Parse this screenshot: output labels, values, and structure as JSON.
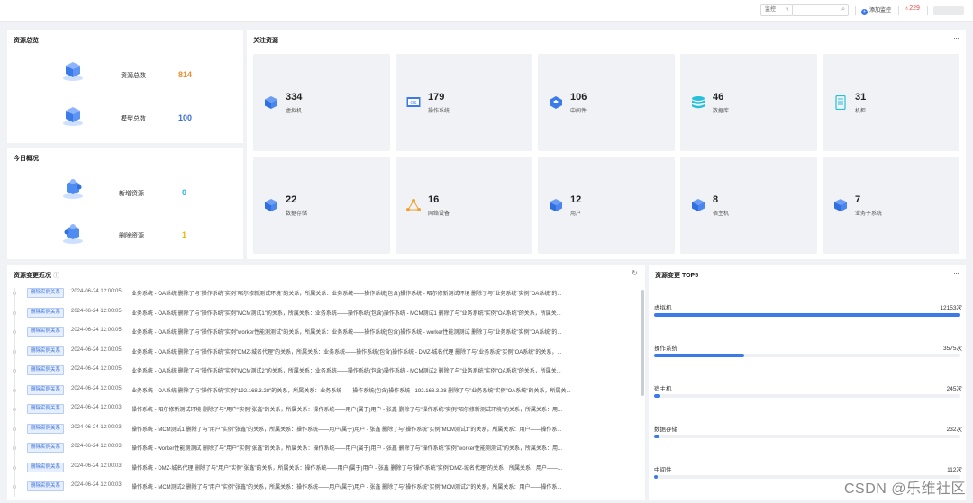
{
  "topbar": {
    "select_value": "监控",
    "add_label": "添加监控",
    "alert_count": "229"
  },
  "summary": {
    "title": "资源总览",
    "items": [
      {
        "label": "资源总数",
        "value": "814",
        "color": "#f08c2e"
      },
      {
        "label": "模型总数",
        "value": "100",
        "color": "#3a6fd8"
      }
    ]
  },
  "today": {
    "title": "今日概况",
    "items": [
      {
        "label": "新增资源",
        "value": "0",
        "color": "#2bb3e6"
      },
      {
        "label": "删除资源",
        "value": "1",
        "color": "#f0b400"
      }
    ]
  },
  "focus": {
    "title": "关注资源",
    "more": "···",
    "cards": [
      {
        "count": "334",
        "label": "虚拟机",
        "icon": "cube-icon"
      },
      {
        "count": "179",
        "label": "操作系统",
        "icon": "os-icon"
      },
      {
        "count": "106",
        "label": "中间件",
        "icon": "cube-icon"
      },
      {
        "count": "46",
        "label": "数据库",
        "icon": "database-icon"
      },
      {
        "count": "31",
        "label": "机柜",
        "icon": "cabinet-icon"
      },
      {
        "count": "22",
        "label": "数据存储",
        "icon": "cube-icon"
      },
      {
        "count": "16",
        "label": "网络设备",
        "icon": "network-icon"
      },
      {
        "count": "12",
        "label": "用户",
        "icon": "cube-icon"
      },
      {
        "count": "8",
        "label": "宿主机",
        "icon": "cube-icon"
      },
      {
        "count": "7",
        "label": "业务子系统",
        "icon": "cube-icon"
      }
    ]
  },
  "changes": {
    "title": "资源变更近况",
    "rows": [
      {
        "badge": "删除实例关系",
        "time": "2024-06-24 12:00:05",
        "text": "业务系统 - OA系统   删除了与\"操作系统\"实例\"昭尔修新测试环境\"的关系，所属关系：业务系统——操作系统(包含)操作系统 - 昭尔修新测试环境   删除了与\"业务系统\"实例\"OA系统\"的..."
      },
      {
        "badge": "删除实例关系",
        "time": "2024-06-24 12:00:05",
        "text": "业务系统 - OA系统   删除了与\"操作系统\"实例\"MCM测试1\"的关系，所属关系：业务系统——操作系统(包含)操作系统 - MCM测试1   删除了与\"业务系统\"实例\"OA系统\"的关系，所属关..."
      },
      {
        "badge": "删除实例关系",
        "time": "2024-06-24 12:00:05",
        "text": "业务系统 - OA系统   删除了与\"操作系统\"实例\"worker性能测测试\"的关系，所属关系：业务系统——操作系统(包含)操作系统 - worker性能测测试   删除了与\"业务系统\"实例\"OA系统\"的..."
      },
      {
        "badge": "删除实例关系",
        "time": "2024-06-24 12:00:05",
        "text": "业务系统 - OA系统   删除了与\"操作系统\"实例\"DMZ-城名代理\"的关系，所属关系：业务系统——操作系统(包含)操作系统 - DMZ-城名代理   删除了与\"业务系统\"实例\"OA系统\"的关系，..."
      },
      {
        "badge": "删除实例关系",
        "time": "2024-06-24 12:00:05",
        "text": "业务系统 - OA系统   删除了与\"操作系统\"实例\"MCM测试2\"的关系，所属关系：业务系统——操作系统(包含)操作系统 - MCM测试2   删除了与\"业务系统\"实例\"OA系统\"的关系，所属关..."
      },
      {
        "badge": "删除实例关系",
        "time": "2024-06-24 12:00:05",
        "text": "业务系统 - OA系统   删除了与\"操作系统\"实例\"192.168.3.28\"的关系，所属关系：业务系统——操作系统(包含)操作系统 - 192.168.3.28   删除了与\"业务系统\"实例\"OA系统\"的关系，所属关..."
      },
      {
        "badge": "删除实例关系",
        "time": "2024-06-24 12:00:03",
        "text": "操作系统 - 昭尔修新测试环境   删除了与\"用户\"实例\"张鑫\"的关系，所属关系：操作系统——用户(属于)用户 - 张鑫   删除了与\"操作系统\"实例\"昭尔修新测试环境\"的关系，所属关系：用..."
      },
      {
        "badge": "删除实例关系",
        "time": "2024-06-24 12:00:03",
        "text": "操作系统 - MCM测试1   删除了与\"用户\"实例\"张鑫\"的关系，所属关系：操作系统——用户(属于)用户 - 张鑫   删除了与\"操作系统\"实例\"MCM测试1\"的关系，所属关系：用户——操作系..."
      },
      {
        "badge": "删除实例关系",
        "time": "2024-06-24 12:00:03",
        "text": "操作系统 - worker性能测测试   删除了与\"用户\"实例\"张鑫\"的关系，所属关系：操作系统——用户(属于)用户 - 张鑫   删除了与\"操作系统\"实例\"worker性能测测试\"的关系，所属关系：用..."
      },
      {
        "badge": "删除实例关系",
        "time": "2024-06-24 12:00:03",
        "text": "操作系统 - DMZ-城名代理   删除了与\"用户\"实例\"张鑫\"的关系，所属关系：操作系统——用户(属于)用户 - 张鑫   删除了与\"操作系统\"实例\"DMZ-城名代理\"的关系，所属关系：用户——..."
      },
      {
        "badge": "删除实例关系",
        "time": "2024-06-24 12:00:03",
        "text": "操作系统 - MCM测试2   删除了与\"用户\"实例\"张鑫\"的关系，所属关系：操作系统——用户(属于)用户 - 张鑫   删除了与\"操作系统\"实例\"MCM测试2\"的关系，所属关系：用户——操作系..."
      }
    ]
  },
  "tops": {
    "title": "资源变更 TOP5",
    "more": "···",
    "items": [
      {
        "label": "虚拟机",
        "value": "12153次",
        "ratio": 1.0
      },
      {
        "label": "操作系统",
        "value": "3575次",
        "ratio": 0.294
      },
      {
        "label": "宿主机",
        "value": "245次",
        "ratio": 0.02
      },
      {
        "label": "数据存储",
        "value": "232次",
        "ratio": 0.019
      },
      {
        "label": "中间件",
        "value": "112次",
        "ratio": 0.009
      }
    ]
  },
  "watermark": "CSDN @乐维社区"
}
